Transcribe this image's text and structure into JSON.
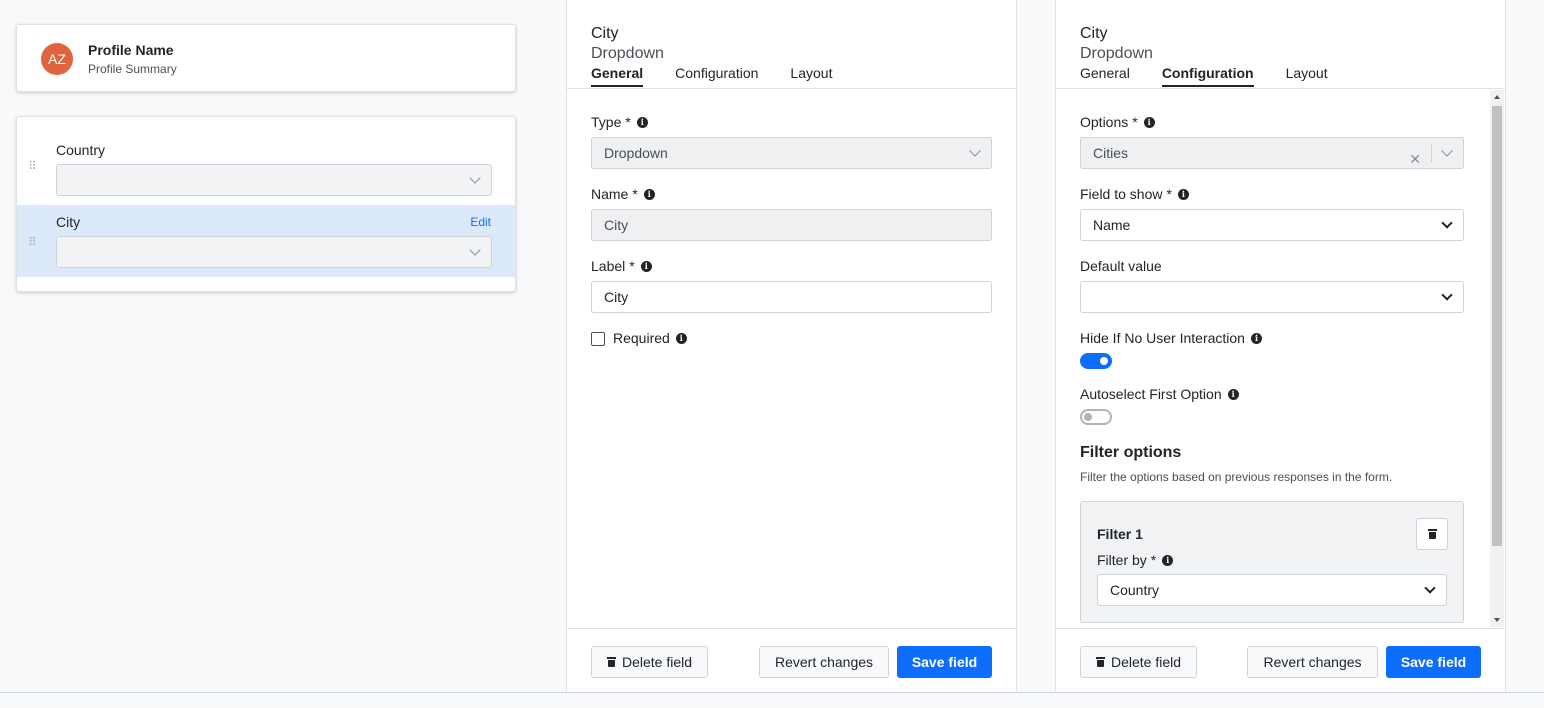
{
  "profile": {
    "initials": "AZ",
    "name": "Profile Name",
    "summary": "Profile Summary"
  },
  "form_fields": [
    {
      "label": "Country"
    },
    {
      "label": "City",
      "edit_label": "Edit"
    }
  ],
  "panel_general": {
    "title": "City",
    "subtitle": "Dropdown",
    "tabs": [
      "General",
      "Configuration",
      "Layout"
    ],
    "active_tab": "General",
    "type_label": "Type",
    "type_value": "Dropdown",
    "name_label": "Name",
    "name_value": "City",
    "label_label": "Label",
    "label_value": "City",
    "required_label": "Required",
    "required_marker": "*"
  },
  "panel_config": {
    "title": "City",
    "subtitle": "Dropdown",
    "tabs": [
      "General",
      "Configuration",
      "Layout"
    ],
    "active_tab": "Configuration",
    "options_label": "Options",
    "options_value": "Cities",
    "field_to_show_label": "Field to show",
    "field_to_show_value": "Name",
    "default_value_label": "Default value",
    "default_value_value": "",
    "hide_label": "Hide If No User Interaction",
    "hide_on": true,
    "autoselect_label": "Autoselect First Option",
    "autoselect_on": false,
    "filter_heading": "Filter options",
    "filter_desc": "Filter the options based on previous responses in the form.",
    "filter_title": "Filter 1",
    "filter_by_label": "Filter by",
    "filter_by_value": "Country"
  },
  "footer": {
    "delete_label": "Delete field",
    "revert_label": "Revert changes",
    "save_label": "Save field"
  },
  "colors": {
    "primary": "#0d6efd",
    "avatar": "#e0653f",
    "selected_row": "#dbe9fb"
  }
}
